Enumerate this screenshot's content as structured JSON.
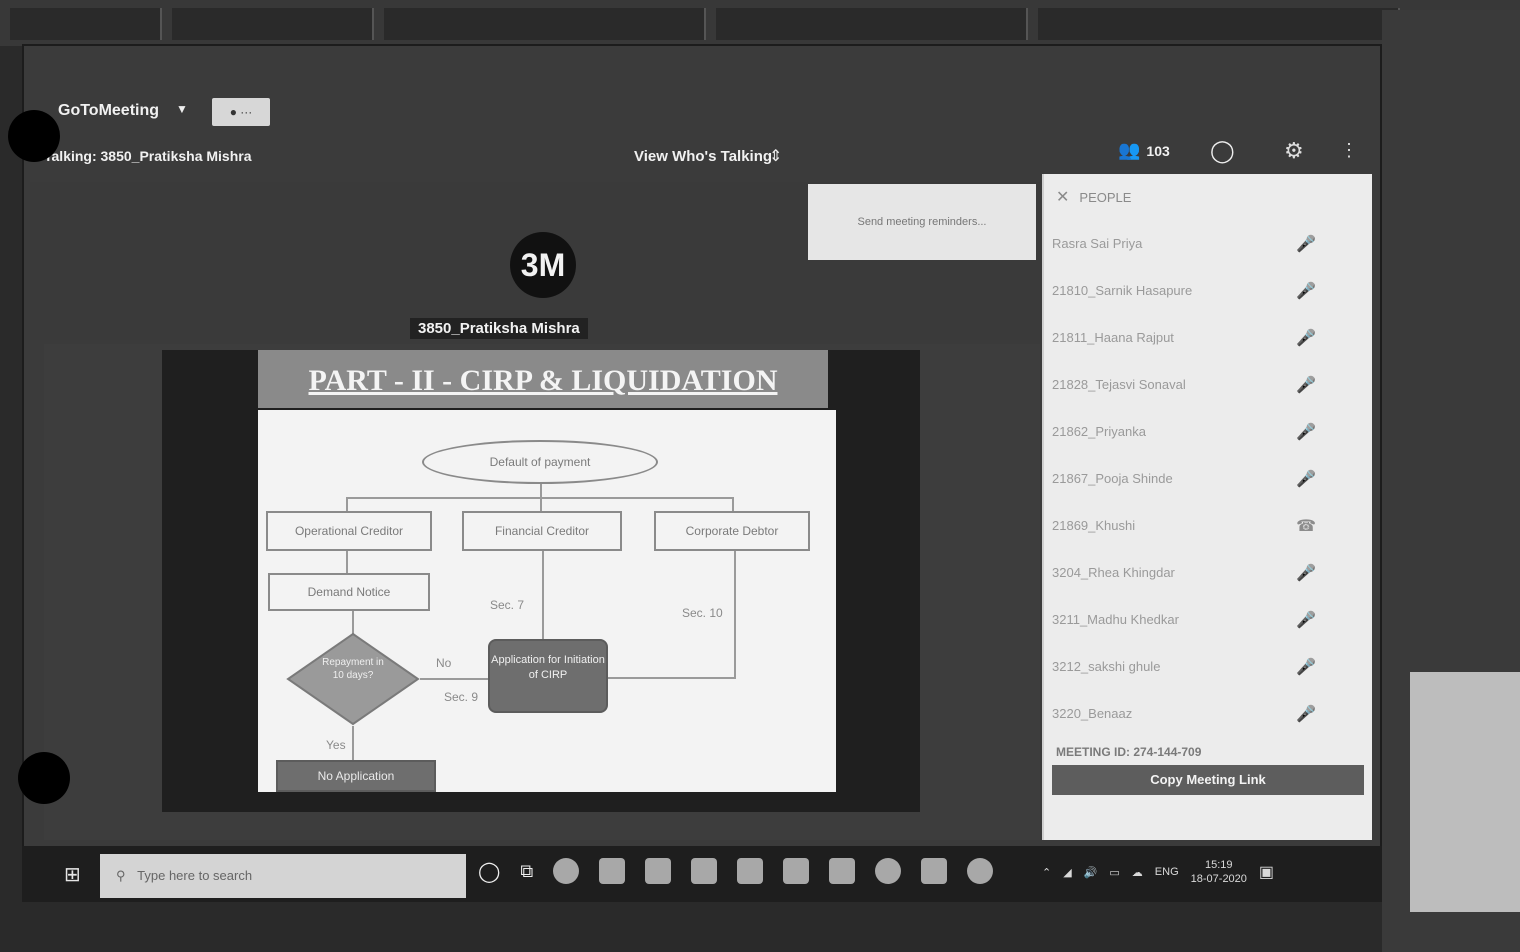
{
  "meeting": {
    "title": "GoToMeeting",
    "speaking_label": "Talking: 3850_Pratiksha Mishra",
    "view_whos_talking": "View Who's Talking",
    "participant_count": "103"
  },
  "video": {
    "avatar_initials": "3M",
    "speaker_name": "3850_Pratiksha Mishra",
    "toast_text": "Send meeting reminders..."
  },
  "slide": {
    "title": "PART - II - CIRP & LIQUIDATION",
    "nodes": {
      "default": "Default of payment",
      "operational": "Operational Creditor",
      "financial": "Financial Creditor",
      "corporate": "Corporate Debtor",
      "demand": "Demand Notice",
      "decision": "Repayment in 10 days?",
      "application": "Application for Initiation of CIRP",
      "no_application": "No Application"
    },
    "labels": {
      "sec7": "Sec. 7",
      "sec10": "Sec. 10",
      "no": "No",
      "sec9": "Sec. 9",
      "yes": "Yes"
    }
  },
  "panel": {
    "header": "PEOPLE",
    "participants": [
      "Rasra Sai Priya",
      "21810_Sarnik Hasapure",
      "21811_Haana Rajput",
      "21828_Tejasvi Sonaval",
      "21862_Priyanka",
      "21867_Pooja Shinde",
      "21869_Khushi",
      "3204_Rhea Khingdar",
      "3211_Madhu Khedkar",
      "3212_sakshi ghule",
      "3220_Benaaz"
    ],
    "meeting_id": "MEETING ID: 274-144-709",
    "copy_link": "Copy Meeting Link"
  },
  "taskbar": {
    "search_placeholder": "Type here to search",
    "lang": "ENG",
    "time": "15:19",
    "date": "18-07-2020"
  }
}
